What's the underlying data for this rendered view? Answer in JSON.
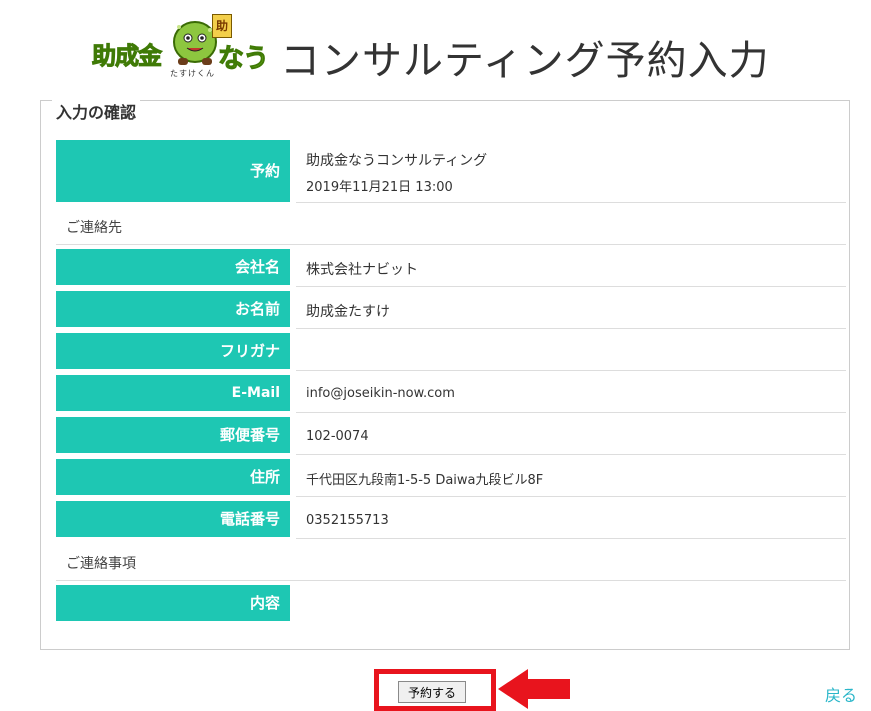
{
  "header": {
    "logo_left": "助成金",
    "logo_right": "なう",
    "logo_badge": "助",
    "logo_subtitle": "たすけくん",
    "title": "コンサルティング予約入力"
  },
  "confirm": {
    "legend": "入力の確認",
    "reservation": {
      "label": "予約",
      "plan": "助成金なうコンサルティング",
      "datetime": "2019年11月21日 13:00"
    },
    "contact_section": "ご連絡先",
    "fields": [
      {
        "label": "会社名",
        "value": "株式会社ナビット"
      },
      {
        "label": "お名前",
        "value": "助成金たすけ"
      },
      {
        "label": "フリガナ",
        "value": ""
      },
      {
        "label": "E-Mail",
        "value": "info@joseikin-now.com"
      },
      {
        "label": "郵便番号",
        "value": "102-0074"
      },
      {
        "label": "住所",
        "value": "千代田区九段南1-5-5 Daiwa九段ビル8F"
      },
      {
        "label": "電話番号",
        "value": "0352155713"
      }
    ],
    "notes_section": "ご連絡事項",
    "content": {
      "label": "内容",
      "value": ""
    }
  },
  "actions": {
    "submit_label": "予約する",
    "back_label": "戻る"
  },
  "colors": {
    "header_cell": "#1ec7b3",
    "highlight": "#e8141d",
    "link": "#29b6c9",
    "logo_green": "#7cc21e"
  }
}
